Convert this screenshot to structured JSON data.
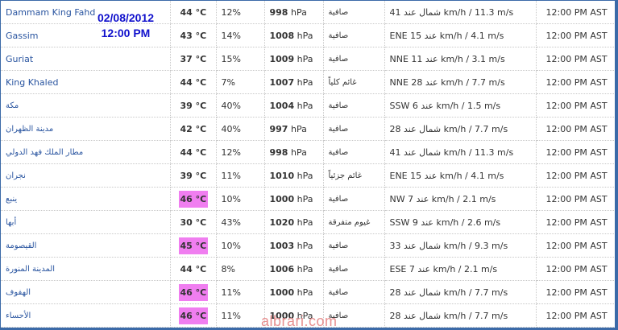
{
  "overlay": {
    "date": "02/08/2012",
    "time": "12:00 PM"
  },
  "watermark": "albrari.com",
  "colors": {
    "hot_highlight": "#f07ef0",
    "link": "#2a55a0",
    "frame": "#3b6aa8",
    "overlay_text": "#1010cc"
  },
  "rows": [
    {
      "station": "Dammam King Fahd",
      "temp": "44 °C",
      "hot": false,
      "humidity": "12%",
      "pressure_val": "998",
      "pressure_unit": "hPa",
      "condition": "صافية",
      "wind": "شمال عند 41 km/h / 11.3 m/s",
      "time": "12:00 PM AST"
    },
    {
      "station": "Gassim",
      "temp": "43 °C",
      "hot": false,
      "humidity": "14%",
      "pressure_val": "1008",
      "pressure_unit": "hPa",
      "condition": "صافية",
      "wind": "ENE 15 عند km/h / 4.1 m/s",
      "time": "12:00 PM AST"
    },
    {
      "station": "Guriat",
      "temp": "37 °C",
      "hot": false,
      "humidity": "15%",
      "pressure_val": "1009",
      "pressure_unit": "hPa",
      "condition": "صافية",
      "wind": "NNE 11 عند km/h / 3.1 m/s",
      "time": "12:00 PM AST"
    },
    {
      "station": "King Khaled",
      "temp": "44 °C",
      "hot": false,
      "humidity": "7%",
      "pressure_val": "1007",
      "pressure_unit": "hPa",
      "condition": "غائم كلياً",
      "wind": "NNE 28 عند km/h / 7.7 m/s",
      "time": "12:00 PM AST"
    },
    {
      "station": "مكة",
      "temp": "39 °C",
      "hot": false,
      "humidity": "40%",
      "pressure_val": "1004",
      "pressure_unit": "hPa",
      "condition": "صافية",
      "wind": "SSW 6 عند km/h / 1.5 m/s",
      "time": "12:00 PM AST"
    },
    {
      "station": "مدينة الظهران",
      "temp": "42 °C",
      "hot": false,
      "humidity": "40%",
      "pressure_val": "997",
      "pressure_unit": "hPa",
      "condition": "صافية",
      "wind": "شمال عند 28 km/h / 7.7 m/s",
      "time": "12:00 PM AST"
    },
    {
      "station": "مطار الملك فهد الدولي",
      "temp": "44 °C",
      "hot": false,
      "humidity": "12%",
      "pressure_val": "998",
      "pressure_unit": "hPa",
      "condition": "صافية",
      "wind": "شمال عند 41 km/h / 11.3 m/s",
      "time": "12:00 PM AST"
    },
    {
      "station": "نجران",
      "temp": "39 °C",
      "hot": false,
      "humidity": "11%",
      "pressure_val": "1010",
      "pressure_unit": "hPa",
      "condition": "غائم جزئياً",
      "wind": "ENE 15 عند km/h / 4.1 m/s",
      "time": "12:00 PM AST"
    },
    {
      "station": "ينبع",
      "temp": "46 °C",
      "hot": true,
      "humidity": "10%",
      "pressure_val": "1000",
      "pressure_unit": "hPa",
      "condition": "صافية",
      "wind": "NW 7 عند km/h / 2.1 m/s",
      "time": "12:00 PM AST"
    },
    {
      "station": "أبها",
      "temp": "30 °C",
      "hot": false,
      "humidity": "43%",
      "pressure_val": "1020",
      "pressure_unit": "hPa",
      "condition": "غيوم متفرقة",
      "wind": "SSW 9 عند km/h / 2.6 m/s",
      "time": "12:00 PM AST"
    },
    {
      "station": "القيصومة",
      "temp": "45 °C",
      "hot": true,
      "humidity": "10%",
      "pressure_val": "1003",
      "pressure_unit": "hPa",
      "condition": "صافية",
      "wind": "شمال عند 33 km/h / 9.3 m/s",
      "time": "12:00 PM AST"
    },
    {
      "station": "المدينة المنورة",
      "temp": "44 °C",
      "hot": false,
      "humidity": "8%",
      "pressure_val": "1006",
      "pressure_unit": "hPa",
      "condition": "صافية",
      "wind": "ESE 7 عند km/h / 2.1 m/s",
      "time": "12:00 PM AST"
    },
    {
      "station": "الهفوف",
      "temp": "46 °C",
      "hot": true,
      "humidity": "11%",
      "pressure_val": "1000",
      "pressure_unit": "hPa",
      "condition": "صافية",
      "wind": "شمال عند 28 km/h / 7.7 m/s",
      "time": "12:00 PM AST"
    },
    {
      "station": "الأحساء",
      "temp": "46 °C",
      "hot": true,
      "humidity": "11%",
      "pressure_val": "1000",
      "pressure_unit": "hPa",
      "condition": "صافية",
      "wind": "شمال عند 28 km/h / 7.7 m/s",
      "time": "12:00 PM AST"
    }
  ]
}
